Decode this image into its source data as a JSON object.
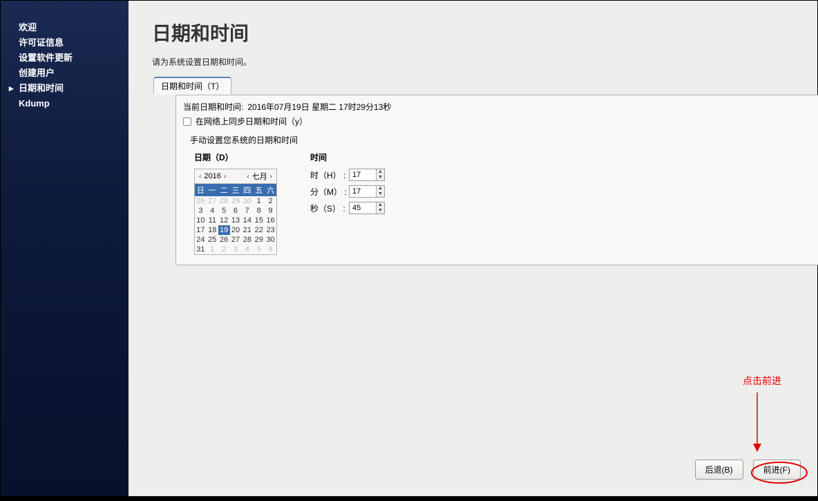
{
  "sidebar": {
    "items": [
      {
        "label": "欢迎",
        "current": false
      },
      {
        "label": "许可证信息",
        "current": false
      },
      {
        "label": "设置软件更新",
        "current": false
      },
      {
        "label": "创建用户",
        "current": false
      },
      {
        "label": "日期和时间",
        "current": true
      },
      {
        "label": "Kdump",
        "current": false
      }
    ]
  },
  "page": {
    "title": "日期和时间",
    "intro": "请为系统设置日期和时间。"
  },
  "tab": {
    "label": "日期和时间（T）"
  },
  "current_dt": {
    "label": "当前日期和时间:",
    "value": "2016年07月19日  星期二  17时29分13秒"
  },
  "ntp": {
    "label": "在网络上同步日期和时间（y）",
    "checked": false
  },
  "manual": {
    "header": "手动设置您系统的日期和时间",
    "date_label": "日期（D）",
    "time_label": "时间"
  },
  "calendar": {
    "year_label": "2016",
    "month_label": "七月",
    "weekdays": [
      "日",
      "一",
      "二",
      "三",
      "四",
      "五",
      "六"
    ],
    "cells": [
      {
        "d": "26",
        "other": true
      },
      {
        "d": "27",
        "other": true
      },
      {
        "d": "28",
        "other": true
      },
      {
        "d": "29",
        "other": true
      },
      {
        "d": "30",
        "other": true
      },
      {
        "d": "1"
      },
      {
        "d": "2"
      },
      {
        "d": "3"
      },
      {
        "d": "4"
      },
      {
        "d": "5"
      },
      {
        "d": "6"
      },
      {
        "d": "7"
      },
      {
        "d": "8"
      },
      {
        "d": "9"
      },
      {
        "d": "10"
      },
      {
        "d": "11"
      },
      {
        "d": "12"
      },
      {
        "d": "13"
      },
      {
        "d": "14"
      },
      {
        "d": "15"
      },
      {
        "d": "16"
      },
      {
        "d": "17"
      },
      {
        "d": "18"
      },
      {
        "d": "19",
        "selected": true
      },
      {
        "d": "20"
      },
      {
        "d": "21"
      },
      {
        "d": "22"
      },
      {
        "d": "23"
      },
      {
        "d": "24"
      },
      {
        "d": "25"
      },
      {
        "d": "26"
      },
      {
        "d": "27"
      },
      {
        "d": "28"
      },
      {
        "d": "29"
      },
      {
        "d": "30"
      },
      {
        "d": "31"
      },
      {
        "d": "1",
        "other": true
      },
      {
        "d": "2",
        "other": true
      },
      {
        "d": "3",
        "other": true
      },
      {
        "d": "4",
        "other": true
      },
      {
        "d": "5",
        "other": true
      },
      {
        "d": "6",
        "other": true
      }
    ]
  },
  "time": {
    "hour_label": "时（H） :",
    "hour_value": "17",
    "minute_label": "分（M） :",
    "minute_value": "17",
    "second_label": "秒（S） :",
    "second_value": "45"
  },
  "buttons": {
    "back": "后退(B)",
    "forward": "前进(F)"
  },
  "annotation": {
    "text": "点击前进"
  }
}
